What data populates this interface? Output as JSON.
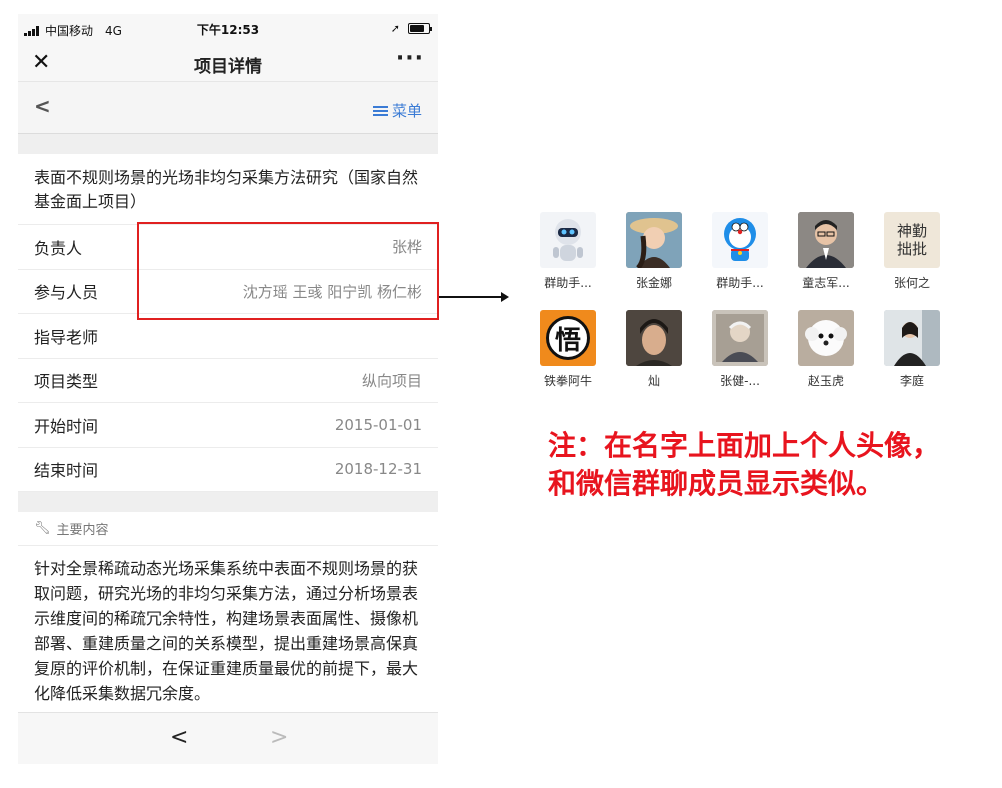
{
  "status": {
    "carrier": "中国移动",
    "network": "4G",
    "time": "下午12:53",
    "battery_level": 0.75
  },
  "nav": {
    "title": "项目详情",
    "close_icon": "close-icon",
    "more_icon": "more-icon"
  },
  "subnav": {
    "menu_label": "菜单"
  },
  "project": {
    "title": "表面不规则场景的光场非均匀采集方法研究（国家自然基金面上项目）",
    "rows": [
      {
        "label": "负责人",
        "value": "张桦"
      },
      {
        "label": "参与人员",
        "value": "沈方瑶 王彧 阳宁凯 杨仁彬"
      },
      {
        "label": "指导老师",
        "value": ""
      },
      {
        "label": "项目类型",
        "value": "纵向项目"
      },
      {
        "label": "开始时间",
        "value": "2015-01-01"
      },
      {
        "label": "结束时间",
        "value": "2018-12-31"
      }
    ],
    "section_title": "主要内容",
    "content": "针对全景稀疏动态光场采集系统中表面不规则场景的获取问题，研究光场的非均匀采集方法，通过分析场景表示维度间的稀疏冗余特性，构建场景表面属性、摄像机部署、重建质量之间的关系模型，提出重建场景高保真复原的评价机制，在保证重建质量最优的前提下，最大化降低采集数据冗余度。"
  },
  "members": [
    {
      "name": "群助手...",
      "avatar": "robot-avatar",
      "bg": "#f2f4f7"
    },
    {
      "name": "张金娜",
      "avatar": "woman-hat-avatar",
      "bg": "#c9a57c"
    },
    {
      "name": "群助手...",
      "avatar": "doraemon-avatar",
      "bg": "#f4f7fb"
    },
    {
      "name": "童志军...",
      "avatar": "man-glasses-avatar",
      "bg": "#6e6a66"
    },
    {
      "name": "张何之",
      "avatar": "calligraphy-avatar",
      "bg": "#efe7d9"
    },
    {
      "name": "铁拳阿牛",
      "avatar": "wu-kanji-avatar",
      "bg": "#f08a1c"
    },
    {
      "name": "灿",
      "avatar": "man-portrait-avatar",
      "bg": "#5d544b"
    },
    {
      "name": "张健-...",
      "avatar": "elder-portrait-avatar",
      "bg": "#b7b1a8"
    },
    {
      "name": "赵玉虎",
      "avatar": "white-dog-avatar",
      "bg": "#d8cfc4"
    },
    {
      "name": "李庭",
      "avatar": "woman-office-avatar",
      "bg": "#bfc7cc"
    }
  ],
  "wu_kanji": "悟",
  "calligraphy_text": "神勤 拙批",
  "note": {
    "line1": "注：在名字上面加上个人头像，",
    "line2": "和微信群聊成员显示类似。"
  },
  "colors": {
    "accent": "#3a7bd5",
    "highlight": "#e02020",
    "note": "#e8141e"
  }
}
